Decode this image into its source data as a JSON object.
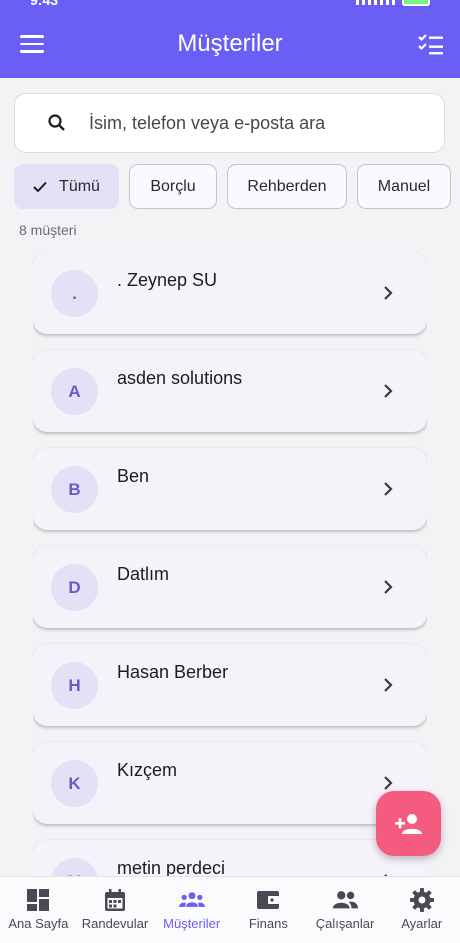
{
  "status": {
    "time": "9:43"
  },
  "header": {
    "title": "Müşteriler"
  },
  "search": {
    "placeholder": "İsim, telefon veya e-posta ara"
  },
  "filters": [
    {
      "label": "Tümü",
      "selected": true
    },
    {
      "label": "Borçlu",
      "selected": false
    },
    {
      "label": "Rehberden",
      "selected": false
    },
    {
      "label": "Manuel",
      "selected": false
    }
  ],
  "count_text": "8 müşteri",
  "customers": [
    {
      "initial": ".",
      "name": ". Zeynep SU"
    },
    {
      "initial": "A",
      "name": "asden solutions"
    },
    {
      "initial": "B",
      "name": "Ben"
    },
    {
      "initial": "D",
      "name": "Datlım"
    },
    {
      "initial": "H",
      "name": "Hasan Berber"
    },
    {
      "initial": "K",
      "name": "Kızçem"
    },
    {
      "initial": "M",
      "name": "metin perdeci"
    }
  ],
  "nav": [
    {
      "label": "Ana Sayfa",
      "icon": "dashboard-icon",
      "active": false
    },
    {
      "label": "Randevular",
      "icon": "calendar-icon",
      "active": false
    },
    {
      "label": "Müşteriler",
      "icon": "people-icon",
      "active": true
    },
    {
      "label": "Finans",
      "icon": "wallet-icon",
      "active": false
    },
    {
      "label": "Çalışanlar",
      "icon": "employees-icon",
      "active": false
    },
    {
      "label": "Ayarlar",
      "icon": "settings-icon",
      "active": false
    }
  ],
  "colors": {
    "primary": "#6a5ff5",
    "fab": "#f55a7f",
    "chip_selected": "#e4e1f6"
  }
}
